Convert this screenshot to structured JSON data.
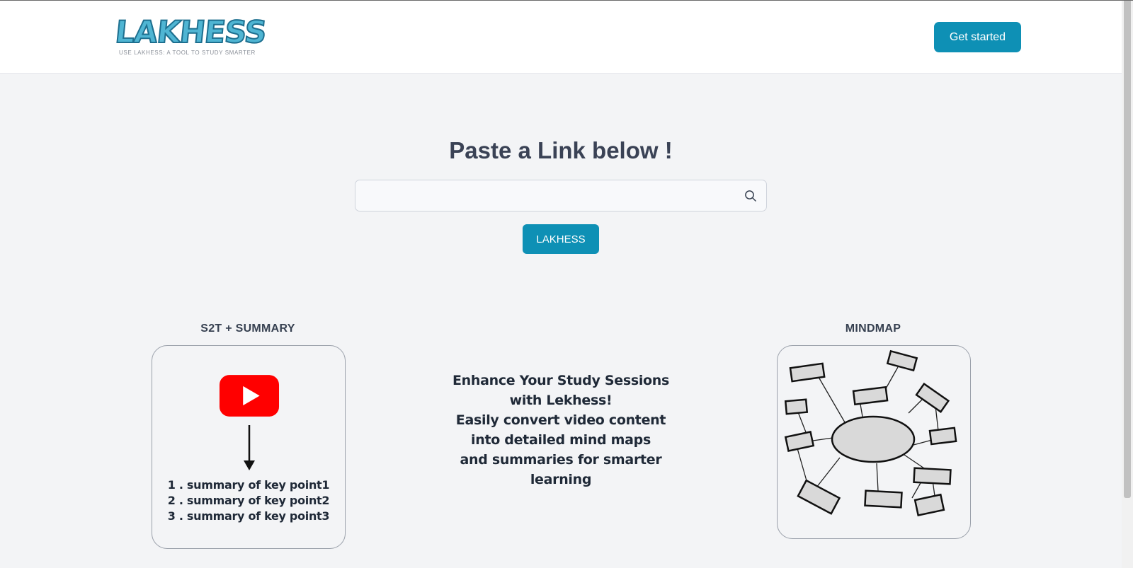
{
  "header": {
    "logo_text": "LAKHESS",
    "logo_tagline": "USE LAKHESS: A TOOL TO STUDY SMARTER",
    "cta_label": "Get started"
  },
  "hero": {
    "title": "Paste a Link below !",
    "search_value": "",
    "search_placeholder": "",
    "submit_label": "LAKHESS"
  },
  "features": {
    "left_title": "S2T + SUMMARY",
    "summary_items": [
      "1 . summary of key point1",
      "2 . summary of key point2",
      "3 . summary of key point3"
    ],
    "center_lines": [
      "Enhance Your Study Sessions",
      "with Lekhess!",
      "Easily convert video content",
      "into detailed mind maps",
      "and summaries for smarter",
      "learning"
    ],
    "right_title": "MINDMAP"
  },
  "icons": {
    "search": "search-icon",
    "video": "youtube-play-icon",
    "arrow": "arrow-down-icon",
    "mindmap": "mindmap-illustration"
  },
  "colors": {
    "accent": "#0e90b5",
    "background": "#f3f4f6",
    "youtube_red": "#ff0000"
  }
}
